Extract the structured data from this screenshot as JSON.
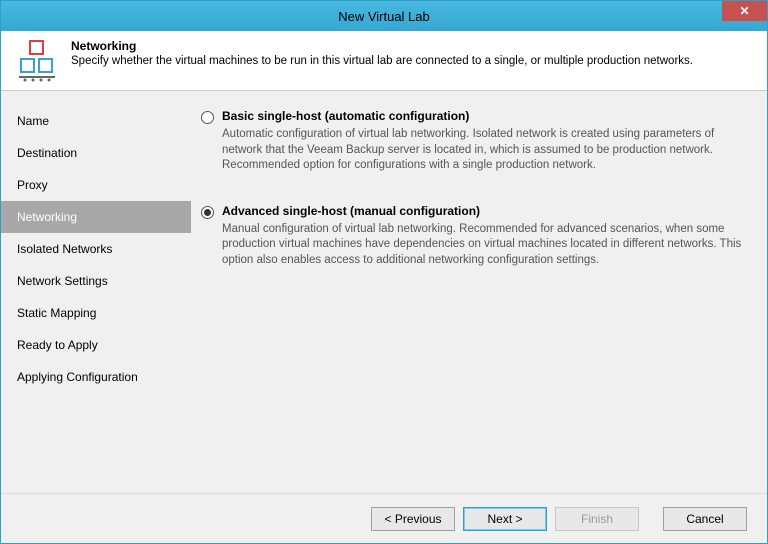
{
  "window": {
    "title": "New Virtual Lab",
    "close": "✕"
  },
  "header": {
    "title": "Networking",
    "subtitle": "Specify whether the virtual machines to be run in this virtual lab are connected to a single, or multiple production networks."
  },
  "sidebar": {
    "items": [
      {
        "label": "Name"
      },
      {
        "label": "Destination"
      },
      {
        "label": "Proxy"
      },
      {
        "label": "Networking"
      },
      {
        "label": "Isolated Networks"
      },
      {
        "label": "Network Settings"
      },
      {
        "label": "Static Mapping"
      },
      {
        "label": "Ready to Apply"
      },
      {
        "label": "Applying Configuration"
      }
    ],
    "active_index": 3
  },
  "options": {
    "basic": {
      "title": "Basic single-host (automatic configuration)",
      "desc": "Automatic configuration of virtual lab networking. Isolated network is created using parameters of network that the Veeam Backup server is located in, which is assumed to be production network. Recommended option for configurations with a single production network.",
      "selected": false
    },
    "advanced": {
      "title": "Advanced single-host (manual configuration)",
      "desc": "Manual configuration of virtual lab networking. Recommended for advanced scenarios, when some production virtual machines have dependencies on virtual machines located in different networks. This option also enables access to additional networking configuration settings.",
      "selected": true
    }
  },
  "footer": {
    "previous": "< Previous",
    "next": "Next >",
    "finish": "Finish",
    "cancel": "Cancel"
  }
}
